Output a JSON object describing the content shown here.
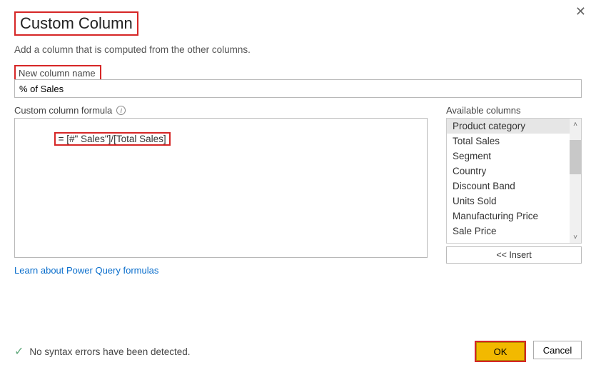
{
  "close_glyph": "✕",
  "title": "Custom Column",
  "subtitle": "Add a column that is computed from the other columns.",
  "name_label": "New column name",
  "name_value": "% of Sales",
  "formula_label": "Custom column formula",
  "formula_text": "= [#\" Sales\"]/[Total Sales]",
  "available_label": "Available columns",
  "columns": [
    "Product category",
    "Total Sales",
    "Segment",
    "Country",
    "Discount Band",
    "Units Sold",
    "Manufacturing Price",
    "Sale Price"
  ],
  "insert_label": "<< Insert",
  "learn_link": "Learn about Power Query formulas",
  "status_text": "No syntax errors have been detected.",
  "ok_label": "OK",
  "cancel_label": "Cancel",
  "up_glyph": "˄",
  "down_glyph": "˅"
}
